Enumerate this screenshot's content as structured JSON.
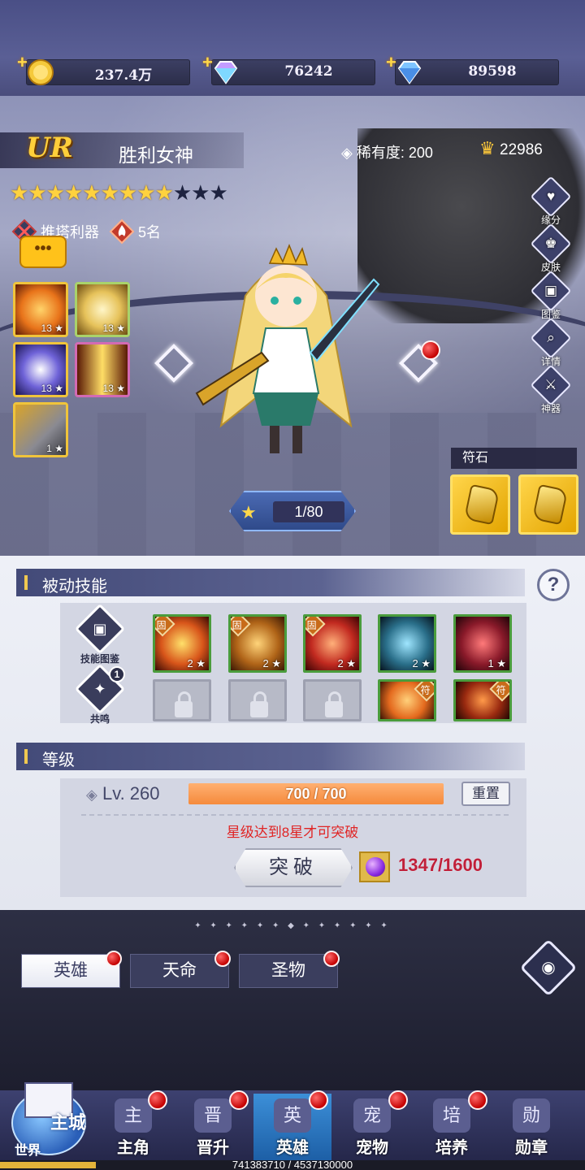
{
  "currencies": [
    {
      "name": "gold",
      "value": "237.4万",
      "icon": "gold-coin-icon"
    },
    {
      "name": "rainbow-gem",
      "value": "76242",
      "icon": "rainbow-diamond-icon"
    },
    {
      "name": "blue-gem",
      "value": "89598",
      "icon": "blue-diamond-icon"
    }
  ],
  "hero": {
    "rank": "UR",
    "name": "胜利女神",
    "rarity_label": "稀有度:",
    "rarity_value": "200",
    "power": "22986",
    "stars_filled": 9,
    "stars_total": 12,
    "tags": [
      "推塔利器",
      "5名"
    ],
    "chat": "•••"
  },
  "active_skills": [
    {
      "level": "13",
      "color": "#e8731a"
    },
    {
      "level": "13",
      "color": "#e6c25a"
    },
    {
      "level": "13",
      "color": "#6f63d8"
    },
    {
      "level": "13",
      "color": "#f08a20"
    },
    {
      "level": "1",
      "color": "#8a8a92"
    }
  ],
  "side_buttons": [
    "缘分",
    "皮肤",
    "图鉴",
    "详情",
    "神器"
  ],
  "rune": {
    "title": "符石"
  },
  "exp": {
    "value": "1/80"
  },
  "passive": {
    "title": "被动技能",
    "help": "?",
    "buttons": [
      "技能图鉴",
      "共鸣"
    ],
    "resonance_badge": "1",
    "skills": [
      {
        "level": "2",
        "gu": "固",
        "color": "#d8551a"
      },
      {
        "level": "2",
        "gu": "固",
        "color": "#b06418"
      },
      {
        "level": "2",
        "gu": "固",
        "color": "#c22a20"
      },
      {
        "level": "2",
        "gu": "",
        "color": "#2a6f8a"
      },
      {
        "level": "1",
        "gu": "",
        "color": "#8a1a2a"
      }
    ],
    "locked_slots": 3,
    "extra_skills": [
      {
        "gu": "符",
        "color": "#e46a1e"
      },
      {
        "gu": "符",
        "color": "#9a2a10"
      }
    ]
  },
  "level": {
    "title": "等级",
    "label": "Lv. 260",
    "progress_text": "700 / 700",
    "progress": 1.0,
    "reset": "重置",
    "note": "星级达到8星才可突破",
    "break_button": "突破",
    "material": "1347/1600"
  },
  "tabs": [
    {
      "label": "英雄",
      "active": true
    },
    {
      "label": "天命",
      "active": false
    },
    {
      "label": "圣物",
      "active": false
    }
  ],
  "world": {
    "main": "主城",
    "sub": "世界"
  },
  "nav": [
    {
      "label": "主角",
      "icon": "主"
    },
    {
      "label": "晋升",
      "icon": "晋"
    },
    {
      "label": "英雄",
      "icon": "英",
      "active": true
    },
    {
      "label": "宠物",
      "icon": "宠"
    },
    {
      "label": "培养",
      "icon": "培"
    },
    {
      "label": "勋章",
      "icon": "勋"
    }
  ],
  "exp_strip": "741383710 / 4537130000",
  "colors": {
    "accent": "#f0c850",
    "alert": "#e02424",
    "material": "#c0203a"
  }
}
